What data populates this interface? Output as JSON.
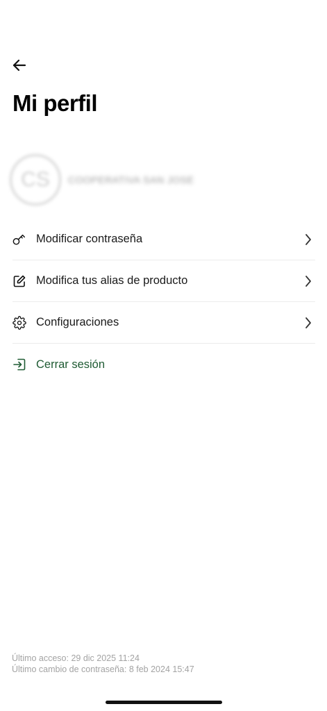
{
  "header": {
    "back_icon": "arrow-left-icon",
    "title": "Mi perfil"
  },
  "profile": {
    "initials": "CS",
    "name": "COOPERATIVA SAN JOSE"
  },
  "menu": {
    "items": [
      {
        "label": "Modificar contraseña",
        "icon": "key-icon"
      },
      {
        "label": "Modifica tus alias de producto",
        "icon": "edit-icon"
      },
      {
        "label": "Configuraciones",
        "icon": "gear-icon"
      }
    ],
    "logout": {
      "label": "Cerrar sesión",
      "icon": "sign-in-icon",
      "color": "#1f5b33"
    }
  },
  "footer": {
    "last_access": "Último acceso: 29 dic 2025 11:24",
    "last_password_change": "Último cambio de contraseña: 8 feb 2024 15:47"
  },
  "colors": {
    "accent": "#1f5b33",
    "footer_text": "#a3a3a3",
    "divider": "#ececec"
  }
}
